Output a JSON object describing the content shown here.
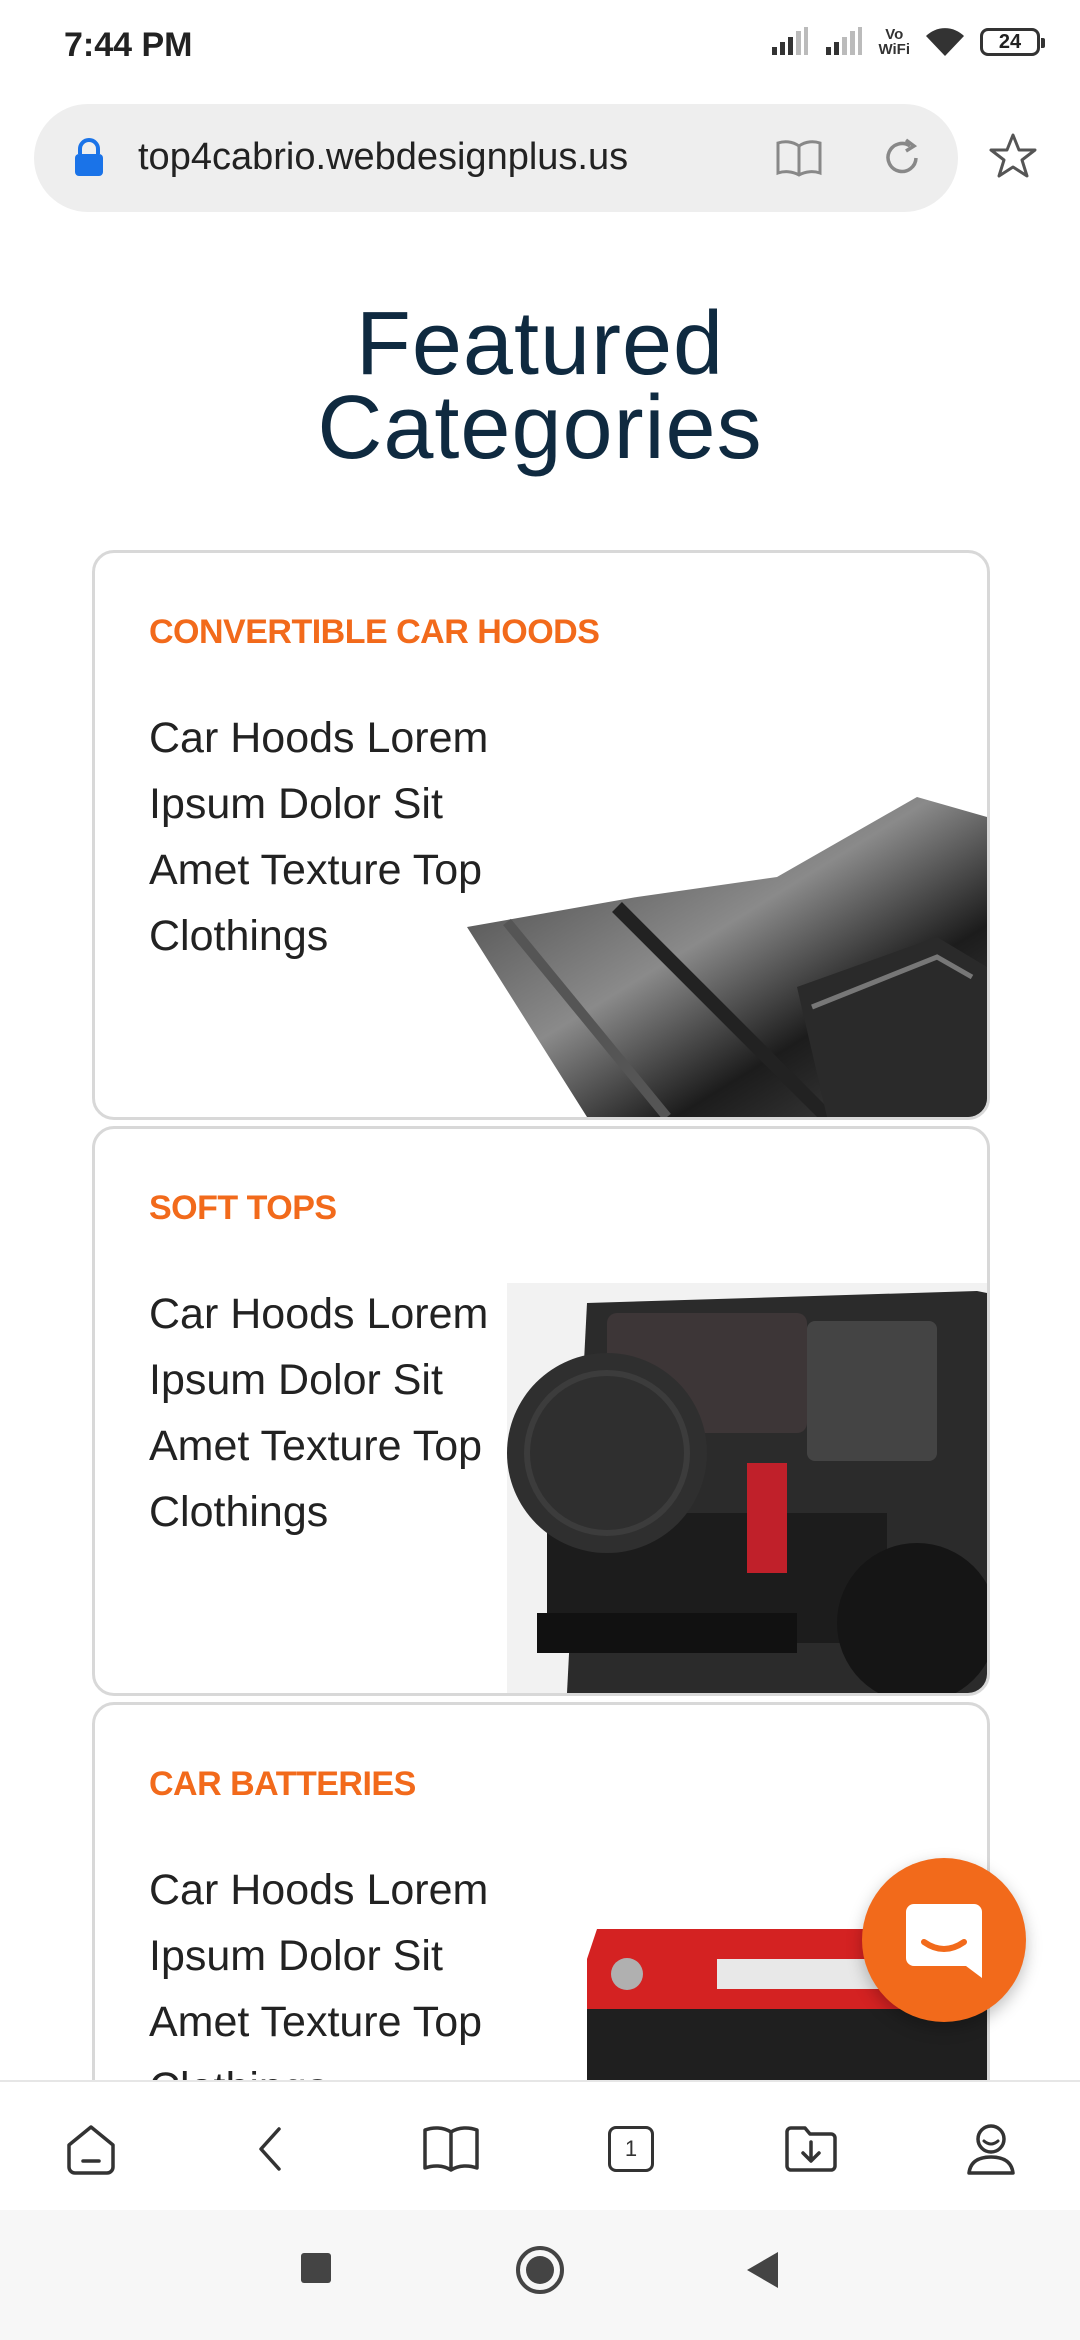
{
  "status_bar": {
    "time": "7:44 PM",
    "vowifi_line1": "Vo",
    "vowifi_line2": "WiFi",
    "battery": "24"
  },
  "browser": {
    "url": "top4cabrio.webdesignplus.us"
  },
  "page": {
    "section_title_line1": "Featured",
    "section_title_line2": "Categories",
    "cards": [
      {
        "title": "CONVERTIBLE CAR HOODS",
        "description": "Car Hoods Lorem Ipsum Dolor Sit Amet Texture Top Clothings",
        "image": "car-hood-image"
      },
      {
        "title": "SOFT TOPS",
        "description": "Car Hoods Lorem Ipsum Dolor Sit Amet Texture Top Clothings",
        "image": "soft-top-jeep-image"
      },
      {
        "title": "CAR BATTERIES",
        "description": "Car Hoods Lorem Ipsum Dolor Sit Amet Texture Top Clothings",
        "image": "car-battery-image"
      }
    ]
  },
  "bottom_nav": {
    "tabs_count": "1"
  },
  "colors": {
    "accent": "#f26a1b",
    "title": "#0f2a40",
    "chrome": "#eeeeee"
  }
}
